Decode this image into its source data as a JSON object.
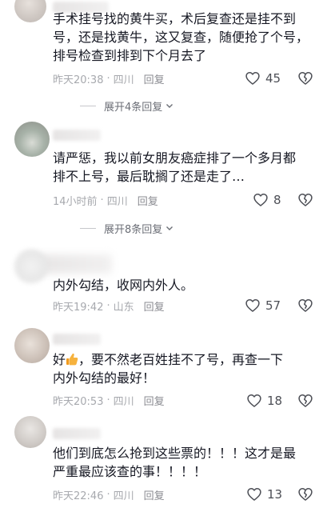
{
  "comments": [
    {
      "text": "手术挂号找的黄牛买，术后复查还是挂不到\n号，还是找黄牛，这又复查，随便抢了个号，\n排号检查到排到下个月去了",
      "time": "昨天20:38",
      "location": "四川",
      "reply": "回复",
      "likes": "45",
      "expand": "展开4条回复"
    },
    {
      "text": "请严惩，我以前女朋友癌症排了一个多月都\n排不上号，最后耽搁了还是走了…",
      "time": "14小时前",
      "location": "四川",
      "reply": "回复",
      "likes": "8",
      "expand": "展开8条回复"
    },
    {
      "text": "内外勾结，收网内外人。",
      "time": "昨天19:42",
      "location": "山东",
      "reply": "回复",
      "likes": "57"
    },
    {
      "text_prefix": "好",
      "text": "，要不然老百姓挂不了号，再查一下\n内外勾结的最好！",
      "time": "昨天20:53",
      "location": "四川",
      "reply": "回复",
      "likes": "18"
    },
    {
      "text": "他们到底怎么抢到这些票的！！！这才是最\n严重最应该查的事！！！！",
      "time": "昨天22:46",
      "location": "四川",
      "reply": "回复",
      "likes": "13"
    }
  ],
  "colors": {
    "text": "#161823",
    "meta": "#a7a9ae",
    "icon": "#4d4f56"
  },
  "icons": {
    "like": "heart-outline-icon",
    "dislike": "broken-heart-icon",
    "expand": "chevron-down-icon",
    "emoji": "thumbs-up-emoji"
  }
}
